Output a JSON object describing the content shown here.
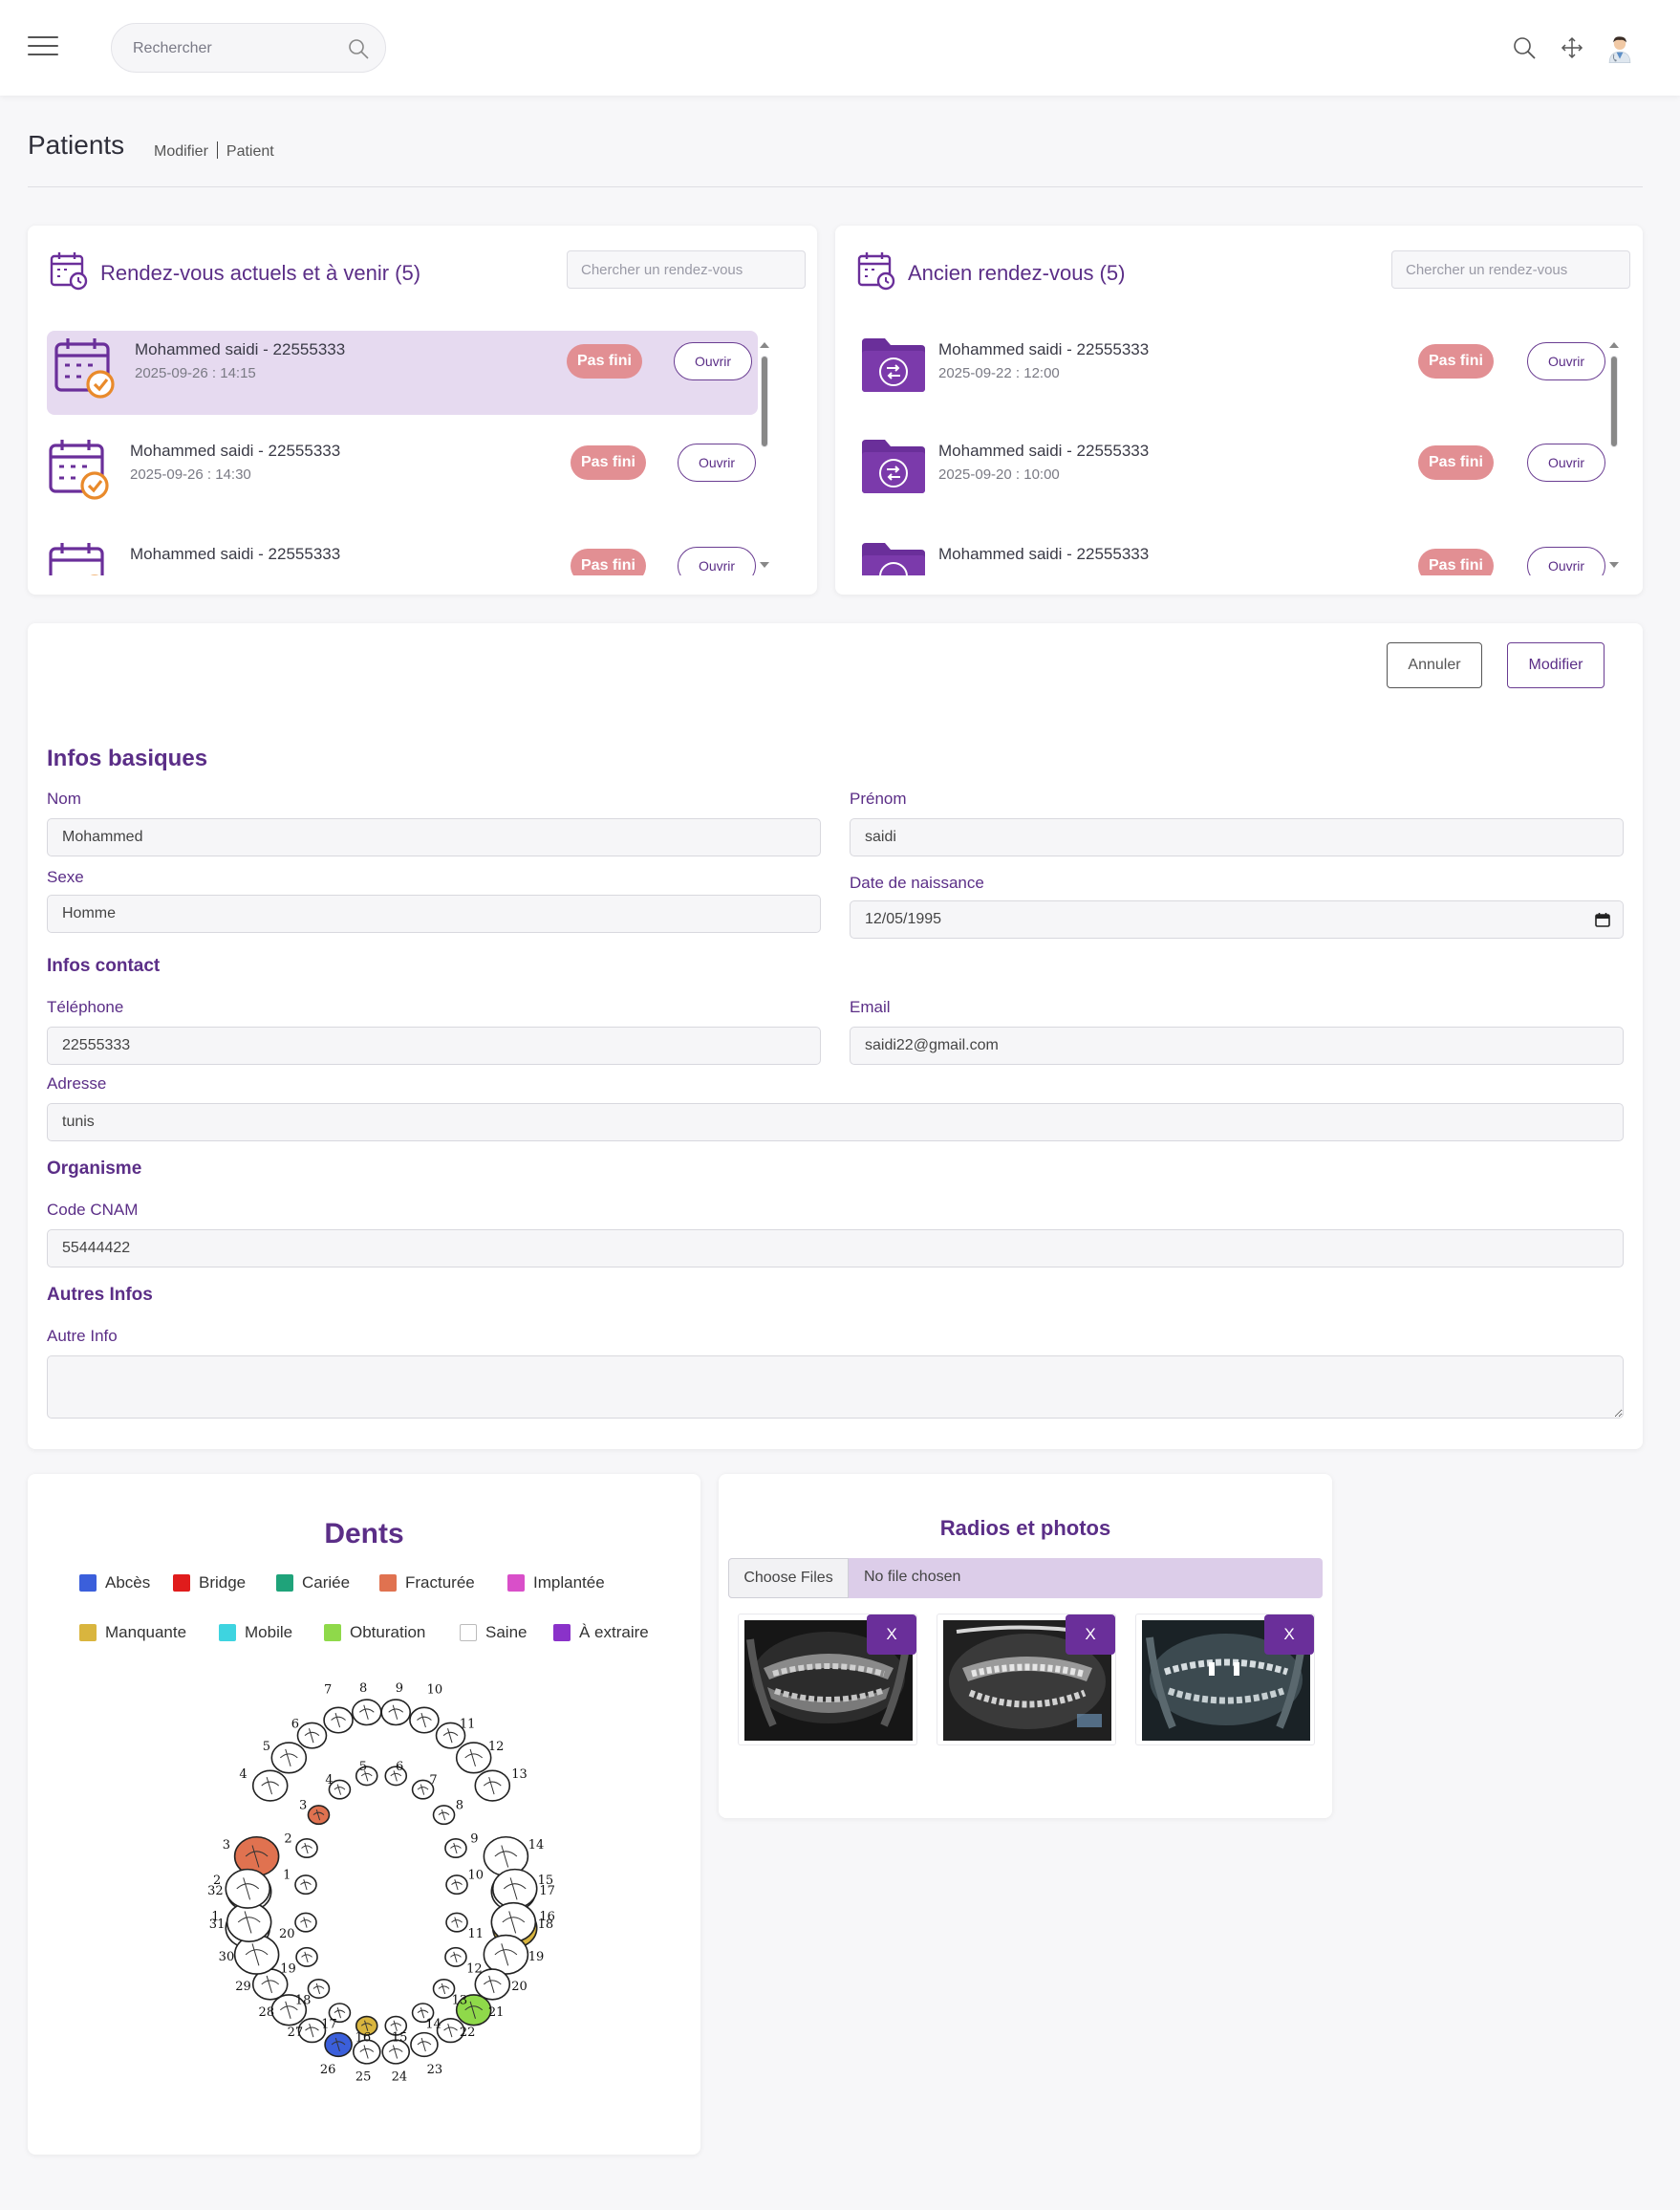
{
  "topbar": {
    "search_placeholder": "Rechercher",
    "icons": [
      "menu-icon",
      "search-icon",
      "fullscreen-icon",
      "doctor-avatar"
    ]
  },
  "page": {
    "title": "Patients",
    "breadcrumb": [
      "Modifier",
      "Patient"
    ]
  },
  "current_appointments": {
    "title": "Rendez-vous actuels et à venir (5)",
    "search_placeholder": "Chercher un rendez-vous",
    "items": [
      {
        "name": "Mohammed saidi - 22555333",
        "datetime": "2025-09-26 : 14:15",
        "status": "Pas fini",
        "action": "Ouvrir",
        "active": true
      },
      {
        "name": "Mohammed saidi - 22555333",
        "datetime": "2025-09-26 : 14:30",
        "status": "Pas fini",
        "action": "Ouvrir",
        "active": false
      },
      {
        "name": "Mohammed saidi - 22555333",
        "datetime": "",
        "status": "Pas fini",
        "action": "Ouvrir",
        "active": false
      }
    ]
  },
  "past_appointments": {
    "title": "Ancien rendez-vous (5)",
    "search_placeholder": "Chercher un rendez-vous",
    "items": [
      {
        "name": "Mohammed saidi - 22555333",
        "datetime": "2025-09-22 : 12:00",
        "status": "Pas fini",
        "action": "Ouvrir"
      },
      {
        "name": "Mohammed saidi - 22555333",
        "datetime": "2025-09-20 : 10:00",
        "status": "Pas fini",
        "action": "Ouvrir"
      },
      {
        "name": "Mohammed saidi - 22555333",
        "datetime": "",
        "status": "Pas fini",
        "action": "Ouvrir"
      }
    ]
  },
  "form": {
    "cancel_label": "Annuler",
    "save_label": "Modifier",
    "basic_title": "Infos basiques",
    "nom_label": "Nom",
    "nom_value": "Mohammed",
    "prenom_label": "Prénom",
    "prenom_value": "saidi",
    "sexe_label": "Sexe",
    "sexe_value": "Homme",
    "dob_label": "Date de naissance",
    "dob_value": "12/05/1995",
    "contact_title": "Infos contact",
    "tel_label": "Téléphone",
    "tel_value": "22555333",
    "email_label": "Email",
    "email_value": "saidi22@gmail.com",
    "adresse_label": "Adresse",
    "adresse_value": "tunis",
    "org_title": "Organisme",
    "cnam_label": "Code CNAM",
    "cnam_value": "55444422",
    "other_title": "Autres Infos",
    "other_label": "Autre Info",
    "other_value": ""
  },
  "teeth": {
    "title": "Dents",
    "legend": [
      {
        "label": "Abcès",
        "color": "#3b5fdb"
      },
      {
        "label": "Bridge",
        "color": "#e01c1c"
      },
      {
        "label": "Cariée",
        "color": "#1fa37a"
      },
      {
        "label": "Fracturée",
        "color": "#e07250"
      },
      {
        "label": "Implantée",
        "color": "#d94fc9"
      },
      {
        "label": "Manquante",
        "color": "#d9b53e"
      },
      {
        "label": "Mobile",
        "color": "#3ed4e0"
      },
      {
        "label": "Obturation",
        "color": "#8fd94a"
      },
      {
        "label": "Saine",
        "color": "#ffffff"
      },
      {
        "label": "À extraire",
        "color": "#8a32c9"
      }
    ],
    "adult_upper_numbers": [
      "1",
      "2",
      "3",
      "4",
      "5",
      "6",
      "7",
      "8",
      "9",
      "10",
      "11",
      "12",
      "13",
      "14",
      "15",
      "16"
    ],
    "adult_lower_numbers": [
      "17",
      "18",
      "19",
      "20",
      "21",
      "22",
      "23",
      "24",
      "25",
      "26",
      "27",
      "28",
      "29",
      "30",
      "31",
      "32"
    ],
    "child_upper_numbers": [
      "1",
      "2",
      "3",
      "4",
      "5",
      "6",
      "7",
      "8",
      "9",
      "10"
    ],
    "child_lower_numbers": [
      "11",
      "12",
      "13",
      "14",
      "15",
      "16",
      "17",
      "18",
      "19",
      "20"
    ],
    "colored_teeth": [
      {
        "tooth": "3",
        "status": "Fracturée"
      },
      {
        "tooth": "16",
        "status": "Manquante"
      },
      {
        "tooth": "21",
        "status": "Obturation"
      },
      {
        "tooth": "26",
        "status": "Abcès"
      }
    ]
  },
  "radios": {
    "title": "Radios et photos",
    "choose_label": "Choose Files",
    "no_file": "No file chosen",
    "remove_label": "X",
    "images": [
      "xray-panoramic-1",
      "xray-panoramic-2",
      "xray-panoramic-3"
    ]
  }
}
